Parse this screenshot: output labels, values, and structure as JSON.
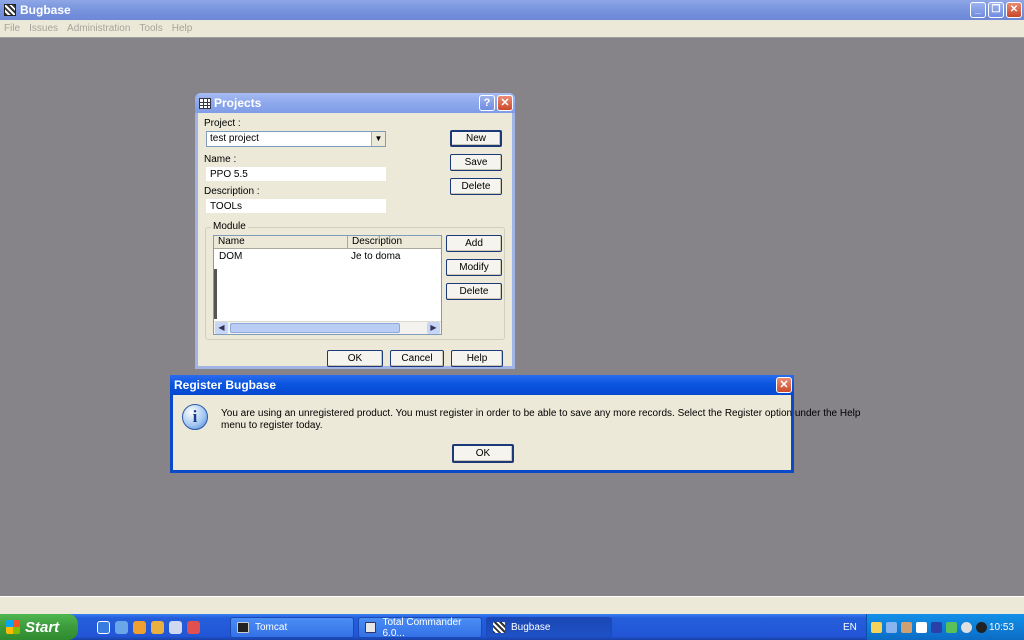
{
  "app": {
    "title": "Bugbase"
  },
  "menu": [
    "File",
    "Issues",
    "Administration",
    "Tools",
    "Help"
  ],
  "projects_dialog": {
    "title": "Projects",
    "help_glyph": "?",
    "close_glyph": "✕",
    "project_label": "Project :",
    "project_value": "test project",
    "name_label": "Name :",
    "name_value": "PPO 5.5",
    "description_label": "Description :",
    "description_value": "TOOLs",
    "new_button": "New",
    "save_button": "Save",
    "delete_button": "Delete",
    "module_group": "Module",
    "columns": [
      "Name",
      "Description"
    ],
    "rows": [
      {
        "name": "DOM",
        "description": "Je to doma"
      }
    ],
    "add_button": "Add",
    "modify_button": "Modify",
    "module_delete_button": "Delete",
    "ok_button": "OK",
    "cancel_button": "Cancel",
    "help_button": "Help"
  },
  "register_dialog": {
    "title": "Register Bugbase",
    "message_line1": "You are using an unregistered product.  You must register in order to be able to save any more records.  Select the Register option under the Help",
    "message_line2": "menu to register today.",
    "ok_button": "OK",
    "info_glyph": "i"
  },
  "taskbar": {
    "start_label": "Start",
    "tasks": [
      {
        "label": "Tomcat",
        "icon": "console-icon",
        "active": false
      },
      {
        "label": "Total Commander 6.0...",
        "icon": "total-commander-icon",
        "active": false
      },
      {
        "label": "Bugbase",
        "icon": "bugbase-icon",
        "active": true
      }
    ],
    "language": "EN",
    "clock": "10:53"
  },
  "colors": {
    "desktop_mdi": "#868489",
    "dialog_face": "#ece9d8",
    "xp_blue_title": "#0a55df",
    "taskbar": "#245edb",
    "start_green": "#3c9b3c"
  }
}
